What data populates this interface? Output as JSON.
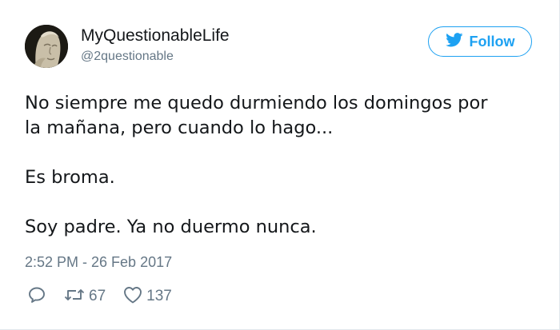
{
  "user": {
    "name": "MyQuestionableLife",
    "handle": "@2questionable",
    "avatar_icon": "statue-face-avatar"
  },
  "follow_button": {
    "label": "Follow",
    "icon": "twitter-bird-icon",
    "color": "#1da1f2"
  },
  "tweet": {
    "lines": [
      "No siempre me quedo durmiendo los domingos por",
      "la mañana, pero cuando lo hago...",
      "Es broma.",
      "Soy padre. Ya no duermo nunca."
    ],
    "timestamp": "2:52 PM - 26 Feb 2017"
  },
  "actions": {
    "reply_icon": "reply-icon",
    "retweet_icon": "retweet-icon",
    "retweet_count": "67",
    "like_icon": "heart-icon",
    "like_count": "137"
  }
}
